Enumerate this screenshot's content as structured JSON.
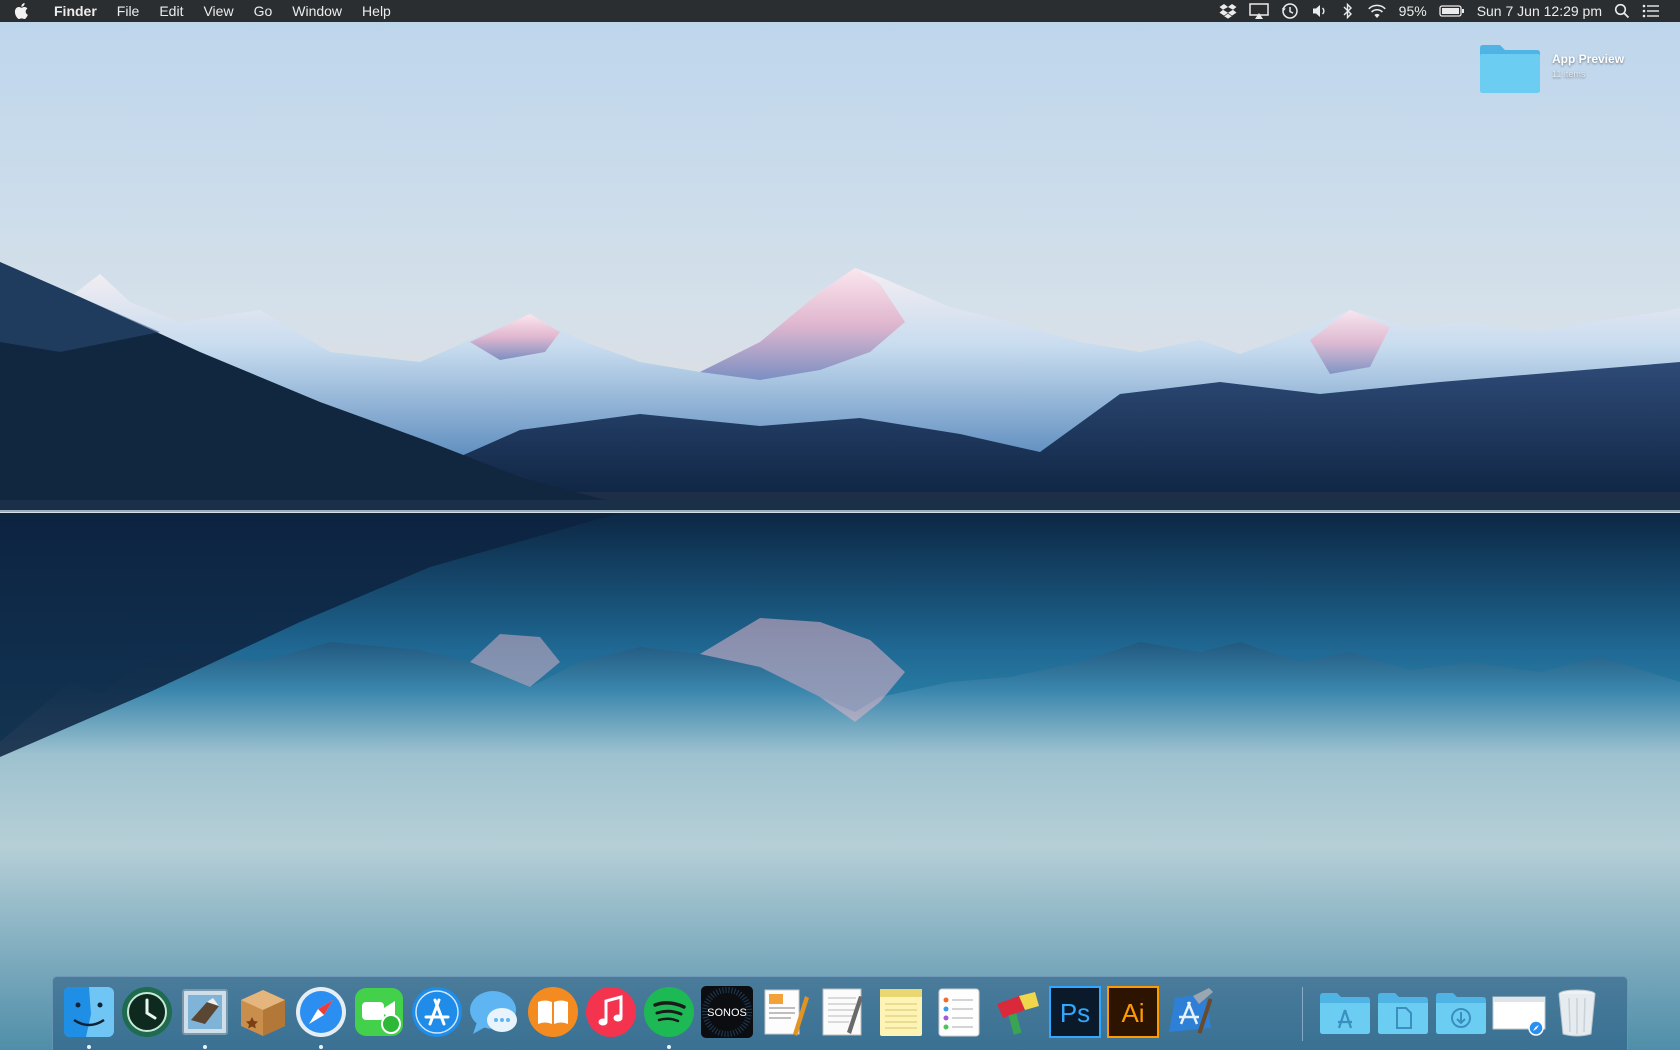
{
  "menubar": {
    "app_name": "Finder",
    "menus": [
      "File",
      "Edit",
      "View",
      "Go",
      "Window",
      "Help"
    ],
    "battery_percent": "95%",
    "datetime": "Sun 7 Jun  12:29 pm"
  },
  "desktop": {
    "folder": {
      "name": "App Preview",
      "subtitle": "11 items"
    }
  },
  "dock": {
    "sonos_label": "SONOS",
    "ps_label": "Ps",
    "ai_label": "Ai",
    "items": [
      "finder",
      "time-machine",
      "mail",
      "archive-utility",
      "safari",
      "facetime",
      "app-store",
      "messages",
      "ibooks",
      "itunes",
      "spotify",
      "sonos",
      "pages",
      "textedit",
      "notes",
      "reminders",
      "transmit",
      "photoshop",
      "illustrator",
      "xcode",
      "applications-folder",
      "documents-folder",
      "downloads-folder",
      "safari-window",
      "trash"
    ]
  },
  "colors": {
    "menubar_bg": "#2b2e31",
    "folder_blue": "#5ec3ef",
    "spotify_green": "#1db954",
    "ps_blue": "#31a8ff",
    "ai_orange": "#ff9a00"
  }
}
